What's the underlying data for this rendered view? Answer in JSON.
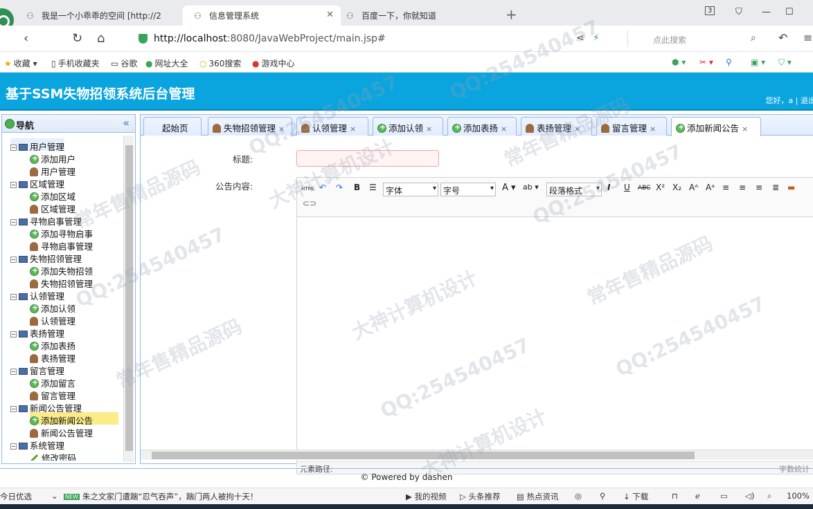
{
  "browser": {
    "tabs": [
      {
        "label": "我是一个小乖乖的空间 [http://2"
      },
      {
        "label": "信息管理系统"
      },
      {
        "label": "百度一下，你就知道"
      }
    ],
    "new_tab": "+",
    "tab_count": "3",
    "url_host": "http://localhost",
    "url_rest": ":8080/JavaWebProject/main.jsp#",
    "search_placeholder": "点此搜索",
    "bookmarks": [
      "收藏",
      "手机收藏夹",
      "谷歌",
      "网址大全",
      "360搜索",
      "游戏中心"
    ]
  },
  "header": {
    "title": "基于SSM失物招领系统后台管理",
    "welcome": "您好，a | 退出"
  },
  "nav": {
    "title": "导航",
    "collapse": "«",
    "groups": [
      {
        "label": "用户管理",
        "children": [
          "添加用户",
          "用户管理"
        ]
      },
      {
        "label": "区域管理",
        "children": [
          "添加区域",
          "区域管理"
        ]
      },
      {
        "label": "寻物启事管理",
        "children": [
          "添加寻物启事",
          "寻物启事管理"
        ]
      },
      {
        "label": "失物招领管理",
        "children": [
          "添加失物招领",
          "失物招领管理"
        ]
      },
      {
        "label": "认领管理",
        "children": [
          "添加认领",
          "认领管理"
        ]
      },
      {
        "label": "表扬管理",
        "children": [
          "添加表扬",
          "表扬管理"
        ]
      },
      {
        "label": "留言管理",
        "children": [
          "添加留言",
          "留言管理"
        ]
      },
      {
        "label": "新闻公告管理",
        "children": [
          "添加新闻公告",
          "新闻公告管理"
        ]
      },
      {
        "label": "系统管理",
        "children": [
          "修改密码"
        ]
      }
    ],
    "selected": "添加新闻公告"
  },
  "tabs": [
    "起始页",
    "失物招领管理",
    "认领管理",
    "添加认领",
    "添加表扬",
    "表扬管理",
    "留言管理",
    "添加新闻公告"
  ],
  "form": {
    "title_label": "标题:",
    "content_label": "公告内容:",
    "font_select": "字体",
    "size_select": "字号",
    "para_select": "段落格式",
    "status_path": "元素路径:",
    "word_count": "字数统计"
  },
  "footer": "© Powered by dashen",
  "statusbar": {
    "left": "今日优选",
    "news_badge": "NEW",
    "news": "朱之文家门遭踹“忍气吞声”，踹门两人被拘十天！",
    "items": [
      "我的视频",
      "头条推荐",
      "热点资讯",
      "下载"
    ],
    "zoom": "100%"
  },
  "watermark": "QQ:254540457",
  "watermark2": "常年售精品源码",
  "watermark3": "大神计算机设计"
}
